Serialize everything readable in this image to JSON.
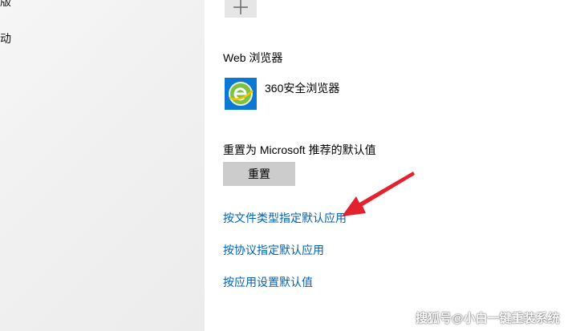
{
  "sidebar": {
    "items": [
      {
        "label": "版"
      },
      {
        "label": "动"
      }
    ]
  },
  "default_apps": {
    "web_browser": {
      "heading": "Web 浏览器",
      "app_name": "360安全浏览器",
      "icon": "360-browser-icon"
    },
    "reset": {
      "heading": "重置为 Microsoft 推荐的默认值",
      "button_label": "重置"
    },
    "links": [
      {
        "label": "按文件类型指定默认应用"
      },
      {
        "label": "按协议指定默认应用"
      },
      {
        "label": "按应用设置默认值"
      }
    ]
  },
  "annotation": {
    "color": "#e4222f"
  },
  "watermark": {
    "text": "搜狐号@小白一键重装系统"
  },
  "colors": {
    "link": "#0063b1",
    "accent_tile": "#0a78d4",
    "button_bg": "#cccccc"
  }
}
